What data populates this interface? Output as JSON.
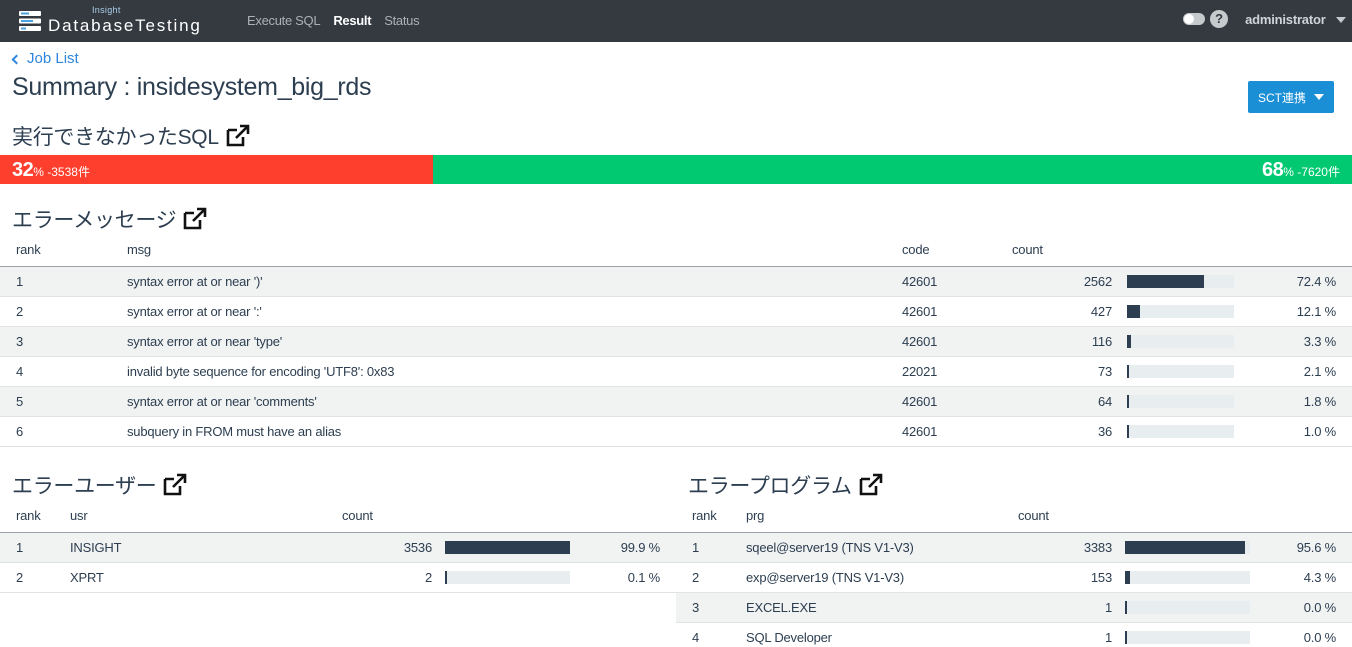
{
  "navbar": {
    "brand_small": "Insight",
    "brand_big": "DatabaseTesting",
    "links": [
      {
        "label": "Execute SQL",
        "active": false
      },
      {
        "label": "Result",
        "active": true
      },
      {
        "label": "Status",
        "active": false
      }
    ],
    "help_label": "?",
    "user": "administrator"
  },
  "header": {
    "back_link": "Job List",
    "title": "Summary : insidesystem_big_rds",
    "sct_button": "SCT連携"
  },
  "unexecuted": {
    "title": "実行できなかったSQL",
    "fail_percent": 32,
    "fail_num": "32",
    "fail_sub": "% -3538件",
    "ok_percent": 68,
    "ok_num": "68",
    "ok_sub": "% -7620件",
    "fail_color": "#ff3f2d",
    "ok_color": "#00c972"
  },
  "error_messages": {
    "title": "エラーメッセージ",
    "columns": {
      "rank": "rank",
      "msg": "msg",
      "code": "code",
      "count": "count"
    },
    "rows": [
      {
        "rank": "1",
        "msg": "syntax error at or near ')'",
        "code": "42601",
        "count": "2562",
        "ratio": 0.724,
        "pct": "72.4 %"
      },
      {
        "rank": "2",
        "msg": "syntax error at or near ':'",
        "code": "42601",
        "count": "427",
        "ratio": 0.121,
        "pct": "12.1 %"
      },
      {
        "rank": "3",
        "msg": "syntax error at or near 'type'",
        "code": "42601",
        "count": "116",
        "ratio": 0.033,
        "pct": "3.3 %"
      },
      {
        "rank": "4",
        "msg": "invalid byte sequence for encoding 'UTF8': 0x83",
        "code": "22021",
        "count": "73",
        "ratio": 0.021,
        "pct": "2.1 %"
      },
      {
        "rank": "5",
        "msg": "syntax error at or near 'comments'",
        "code": "42601",
        "count": "64",
        "ratio": 0.018,
        "pct": "1.8 %"
      },
      {
        "rank": "6",
        "msg": "subquery in FROM must have an alias",
        "code": "42601",
        "count": "36",
        "ratio": 0.01,
        "pct": "1.0 %"
      }
    ]
  },
  "error_users": {
    "title": "エラーユーザー",
    "columns": {
      "rank": "rank",
      "usr": "usr",
      "count": "count"
    },
    "rows": [
      {
        "rank": "1",
        "usr": "INSIGHT",
        "count": "3536",
        "ratio": 0.999,
        "pct": "99.9 %"
      },
      {
        "rank": "2",
        "usr": "XPRT",
        "count": "2",
        "ratio": 0.001,
        "pct": "0.1 %"
      }
    ]
  },
  "error_programs": {
    "title": "エラープログラム",
    "columns": {
      "rank": "rank",
      "prg": "prg",
      "count": "count"
    },
    "rows": [
      {
        "rank": "1",
        "prg": "sqeel@server19 (TNS V1-V3)",
        "count": "3383",
        "ratio": 0.956,
        "pct": "95.6 %"
      },
      {
        "rank": "2",
        "prg": "exp@server19 (TNS V1-V3)",
        "count": "153",
        "ratio": 0.043,
        "pct": "4.3 %"
      },
      {
        "rank": "3",
        "prg": "EXCEL.EXE",
        "count": "1",
        "ratio": 0.0,
        "pct": "0.0 %"
      },
      {
        "rank": "4",
        "prg": "SQL Developer",
        "count": "1",
        "ratio": 0.0,
        "pct": "0.0 %"
      }
    ]
  },
  "colors": {
    "accent": "#1b8fd6",
    "bar": "#2c3e50",
    "navbar": "#343a40",
    "link": "#2e86de"
  },
  "icons": [
    "brand-logo-icon",
    "chevron-left-icon",
    "external-link-icon",
    "help-icon",
    "toggle-switch",
    "caret-down-icon"
  ]
}
